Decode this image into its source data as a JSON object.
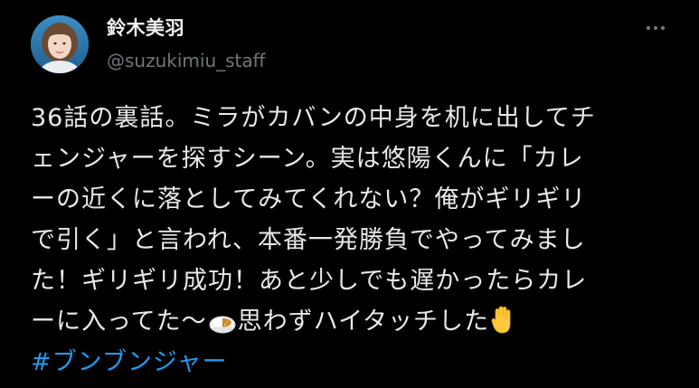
{
  "author": {
    "display_name": "鈴木美羽",
    "handle": "@suzukimiu_staff"
  },
  "tweet": {
    "lines": [
      "36話の裏話。ミラがカバンの中身を机に出してチ",
      "ェンジャーを探すシーン。実は悠陽くんに「カレ",
      "ーの近くに落としてみてくれない？俺がギリギリ",
      "で引く」と言われ、本番一発勝負でやってみまし",
      "た！ギリギリ成功！あと少しでも遅かったらカレ"
    ],
    "last_line_before_emoji": "ーに入ってた〜",
    "last_line_after_emoji": "思わずハイタッチした",
    "hashtag": "#ブンブンジャー"
  },
  "icons": {
    "more": "more-dots-icon",
    "curry": "curry-rice-emoji",
    "hand": "raised-hand-emoji"
  },
  "colors": {
    "background": "#000000",
    "text": "#e7e9ea",
    "secondary": "#71767b",
    "link": "#1d9bf0"
  }
}
